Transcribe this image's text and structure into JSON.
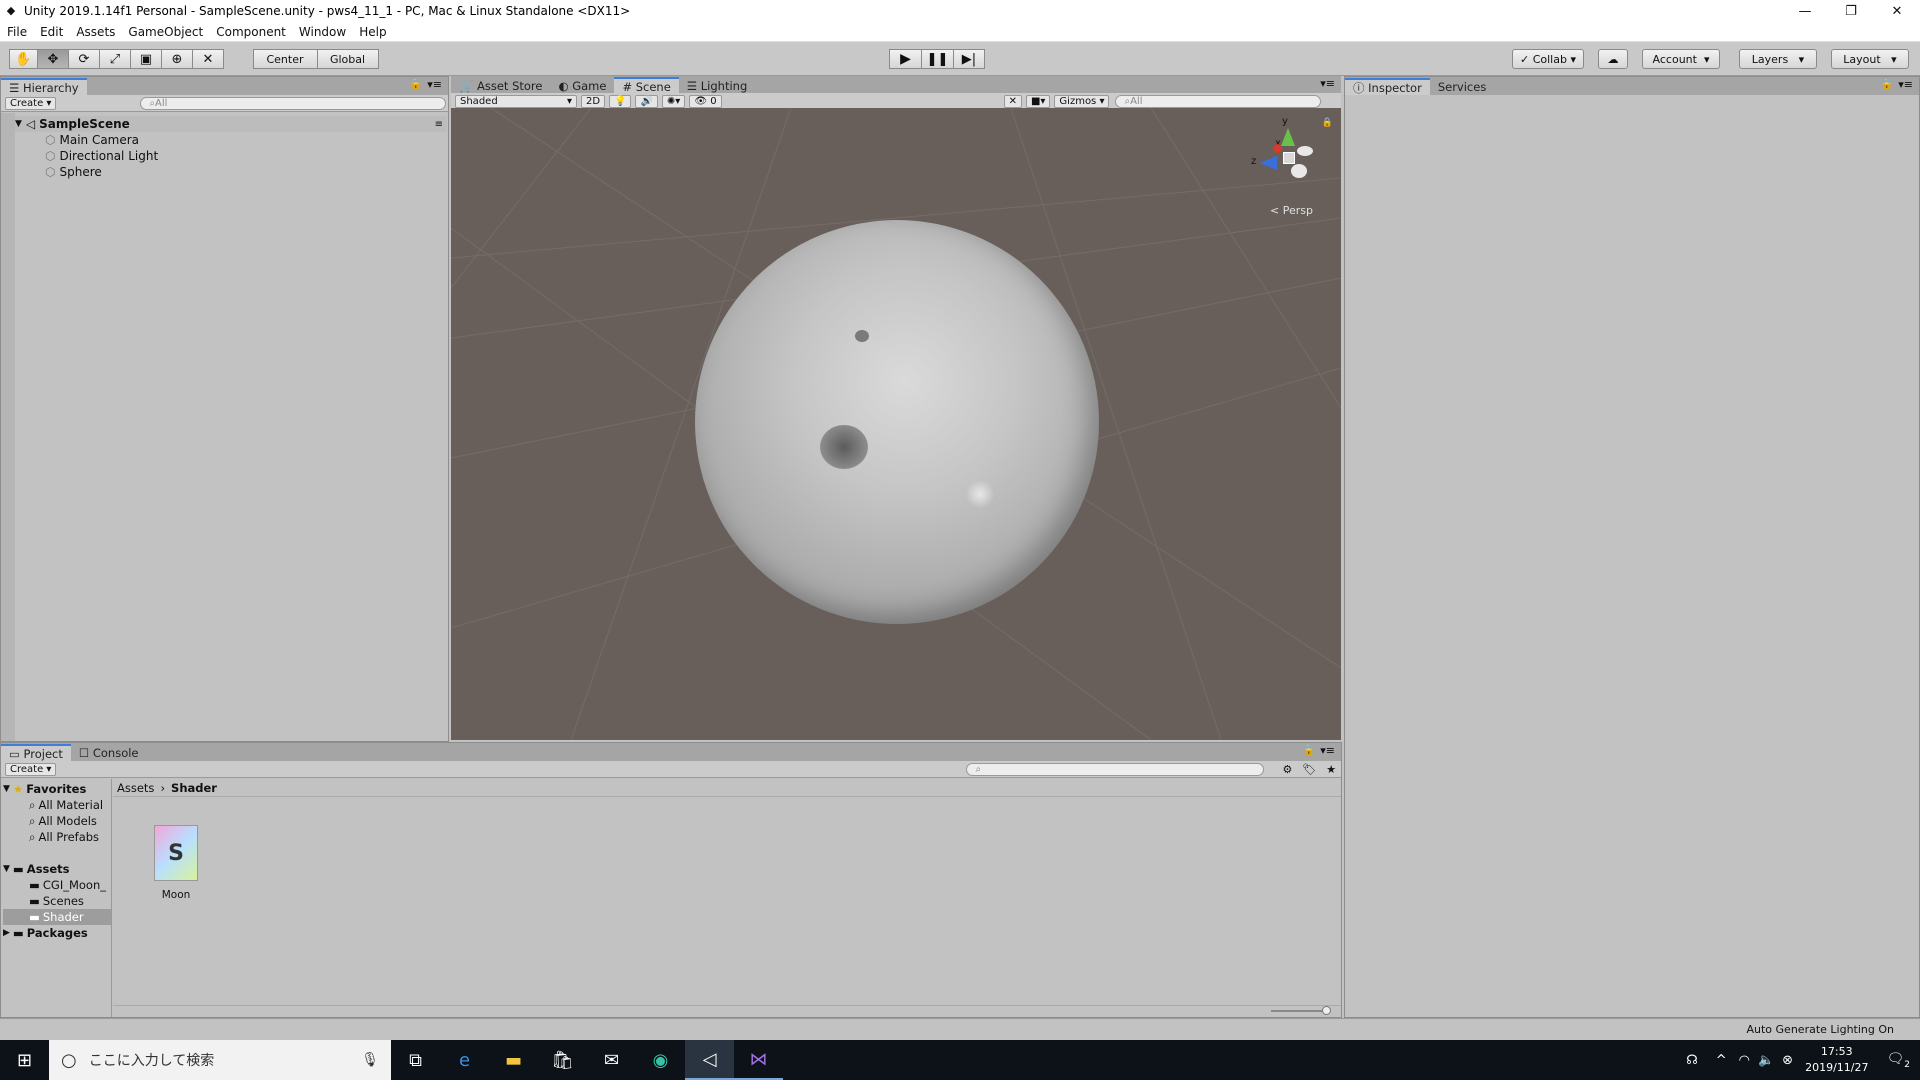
{
  "window": {
    "title": "Unity 2019.1.14f1 Personal - SampleScene.unity - pws4_11_1 - PC, Mac & Linux Standalone <DX11>"
  },
  "menu": [
    "File",
    "Edit",
    "Assets",
    "GameObject",
    "Component",
    "Window",
    "Help"
  ],
  "toolbar": {
    "pivot": "Center",
    "space": "Global",
    "collab": "Collab",
    "account": "Account",
    "layers": "Layers",
    "layout": "Layout"
  },
  "hierarchy": {
    "tab": "Hierarchy",
    "create": "Create",
    "search": "All",
    "scene": "SampleScene",
    "items": [
      "Main Camera",
      "Directional Light",
      "Sphere"
    ]
  },
  "center_tabs": [
    "Asset Store",
    "Game",
    "Scene",
    "Lighting"
  ],
  "scene_bar": {
    "shading": "Shaded",
    "mode2d": "2D",
    "fx_count": "0",
    "gizmos": "Gizmos",
    "search": "All"
  },
  "gizmo": {
    "y": "y",
    "x": "x",
    "z": "z",
    "persp": "< Persp"
  },
  "inspector": {
    "tabs": [
      "Inspector",
      "Services"
    ]
  },
  "project": {
    "tabs": [
      "Project",
      "Console"
    ],
    "create": "Create",
    "favorites_label": "Favorites",
    "favorites": [
      "All Material",
      "All Models",
      "All Prefabs"
    ],
    "assets_label": "Assets",
    "assets": [
      "CGI_Moon_",
      "Scenes",
      "Shader"
    ],
    "packages_label": "Packages",
    "breadcrumb": [
      "Assets",
      "Shader"
    ],
    "asset_item": "Moon",
    "asset_glyph": "S"
  },
  "status": {
    "text": "Auto Generate Lighting On"
  },
  "taskbar": {
    "search": "ここに入力して検索",
    "time": "17:53",
    "date": "2019/11/27",
    "notif": "2"
  }
}
